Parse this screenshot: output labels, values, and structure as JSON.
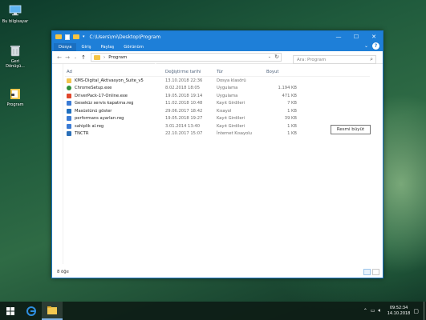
{
  "desktop": {
    "icons": [
      {
        "label": "Bu bilgisayar",
        "icon": "computer-icon"
      },
      {
        "label": "Geri Dönüşü...",
        "icon": "recycle-bin-icon"
      },
      {
        "label": "Program",
        "icon": "folder-icon"
      }
    ]
  },
  "window": {
    "title": "C:\\Users\\mi\\Desktop\\Program",
    "controls": {
      "minimize": "—",
      "maximize": "☐",
      "close": "✕"
    },
    "ribbon_tabs": [
      "Dosya",
      "Giriş",
      "Paylaş",
      "Görünüm"
    ],
    "help": "?",
    "address_path": "Program",
    "search_placeholder": "Ara: Program",
    "columns": {
      "name": "Ad",
      "date": "Değiştirme tarihi",
      "type": "Tür",
      "size": "Boyut"
    },
    "files": [
      {
        "name": "KMS-Digital_Aktivasyon_Suite_v5",
        "date": "13.10.2018 22:36",
        "type": "Dosya klasörü",
        "size": "",
        "icon": "folder-icon",
        "color": "#f2c34c"
      },
      {
        "name": "ChromeSetup.exe",
        "date": "8.02.2018 18:05",
        "type": "Uygulama",
        "size": "1.194 KB",
        "icon": "chrome-icon",
        "color": "#2f8f3a"
      },
      {
        "name": "DriverPack-17-Online.exe",
        "date": "19.05.2018 19:14",
        "type": "Uygulama",
        "size": "471 KB",
        "icon": "driverpack-icon",
        "color": "#e0462c"
      },
      {
        "name": "Geseküz servis kapatma.reg",
        "date": "11.02.2018 10:48",
        "type": "Kayıt Girdileri",
        "size": "7 KB",
        "icon": "registry-icon",
        "color": "#3a7bd5"
      },
      {
        "name": "Masüstünü göster",
        "date": "29.06.2017 18:42",
        "type": "Kısayol",
        "size": "1 KB",
        "icon": "shortcut-icon",
        "color": "#1f6fbf"
      },
      {
        "name": "performans ayarları.reg",
        "date": "19.05.2018 19:27",
        "type": "Kayıt Girdileri",
        "size": "39 KB",
        "icon": "registry-icon",
        "color": "#3a7bd5"
      },
      {
        "name": "sahiplik al.reg",
        "date": "3.01.2014 13:40",
        "type": "Kayıt Girdileri",
        "size": "1 KB",
        "icon": "registry-icon",
        "color": "#3a7bd5"
      },
      {
        "name": "TNCTR",
        "date": "22.10.2017 15:07",
        "type": "İnternet Kısayolu",
        "size": "1 KB",
        "icon": "internet-shortcut-icon",
        "color": "#2a6fb8"
      }
    ],
    "status": "8 öğe",
    "tooltip": "Resmi büyüt"
  },
  "taskbar": {
    "clock_time": "09:52:34",
    "clock_date": "14.10.2018"
  }
}
